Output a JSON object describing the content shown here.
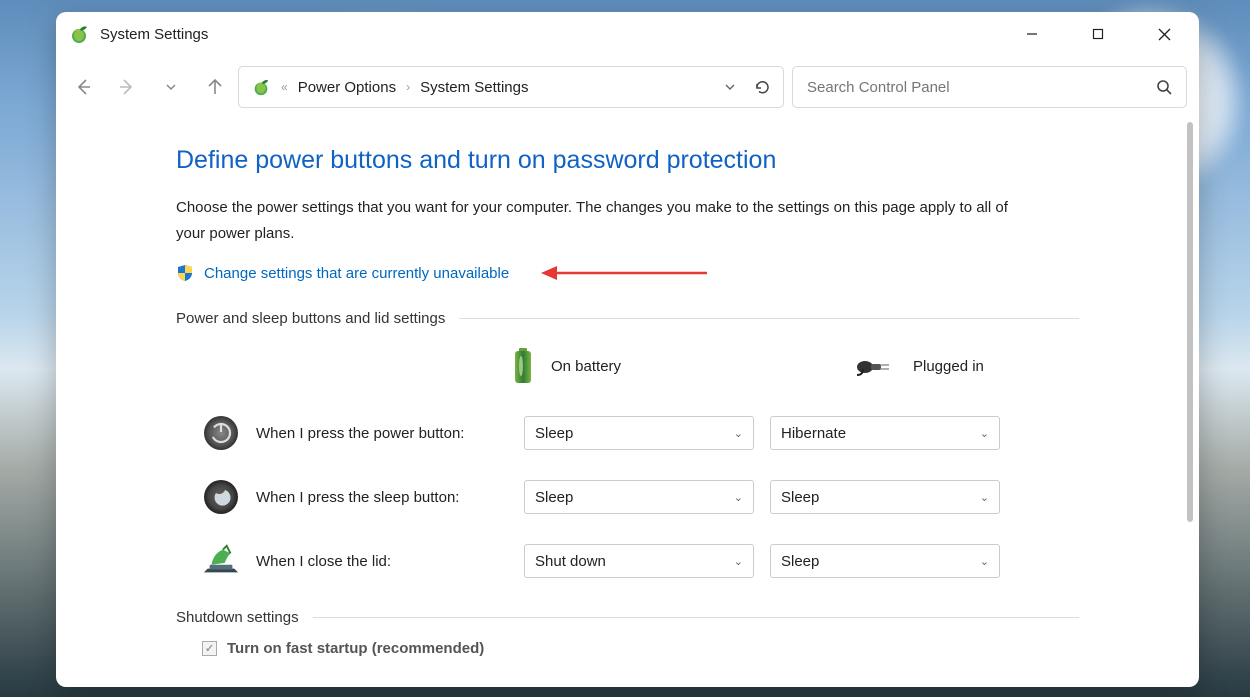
{
  "window": {
    "title": "System Settings"
  },
  "breadcrumbs": {
    "root_marker": "«",
    "seg1": "Power Options",
    "seg2": "System Settings"
  },
  "search": {
    "placeholder": "Search Control Panel"
  },
  "page": {
    "heading": "Define power buttons and turn on password protection",
    "description": "Choose the power settings that you want for your computer. The changes you make to the settings on this page apply to all of your power plans.",
    "change_link": "Change settings that are currently unavailable"
  },
  "section1": {
    "title": "Power and sleep buttons and lid settings",
    "col_battery": "On battery",
    "col_plugged": "Plugged in",
    "rows": [
      {
        "label": "When I press the power button:",
        "battery": "Sleep",
        "plugged": "Hibernate"
      },
      {
        "label": "When I press the sleep button:",
        "battery": "Sleep",
        "plugged": "Sleep"
      },
      {
        "label": "When I close the lid:",
        "battery": "Shut down",
        "plugged": "Sleep"
      }
    ]
  },
  "section2": {
    "title": "Shutdown settings",
    "fast_startup": "Turn on fast startup (recommended)"
  }
}
